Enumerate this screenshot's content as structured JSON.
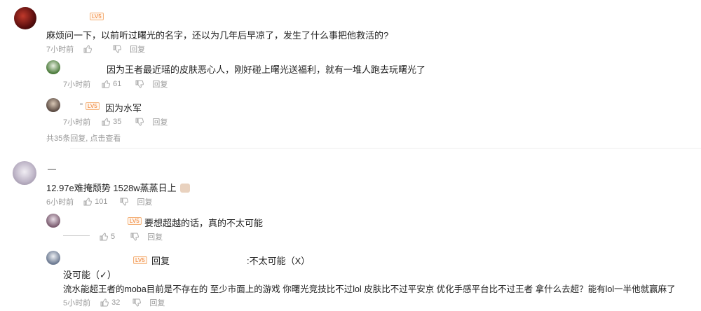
{
  "comments": [
    {
      "id": "c1",
      "text": "麻烦问一下，以前听过曙光的名字，还以为几年后早凉了，发生了什么事把他救活的?",
      "time": "7小时前",
      "likes": "",
      "reply": "回复",
      "replies": [
        {
          "text": "因为王者最近瑶的皮肤恶心人，刚好碰上曙光送福利，就有一堆人跑去玩曙光了",
          "time": "7小时前",
          "likes": "61",
          "reply": "回复"
        },
        {
          "text": "因为水军",
          "time": "7小时前",
          "likes": "35",
          "reply": "回复"
        }
      ],
      "summary": "共35条回复, 点击查看"
    },
    {
      "id": "c2",
      "text": "12.97e难掩颓势 1528w蒸蒸日上",
      "time": "6小时前",
      "likes": "101",
      "reply": "回复",
      "replies": [
        {
          "text": "要想超越的话，真的不太可能",
          "time": "",
          "likes": "5",
          "reply": "回复"
        },
        {
          "prefix": "回复",
          "quote": ":不太可能（X）",
          "line2": "没可能（✓）",
          "line3": "流水能超王者的moba目前是不存在的 至少市面上的游戏 你曙光竞技比不过lol 皮肤比不过平安京 优化手感平台比不过王者 拿什么去超？能有lol一半他就赢麻了",
          "time": "5小时前",
          "likes": "32",
          "reply": "回复"
        }
      ]
    }
  ],
  "badge_text": "LV5",
  "colors": {
    "meta": "#999999",
    "text": "#222222",
    "badge": "#f07d2a"
  }
}
